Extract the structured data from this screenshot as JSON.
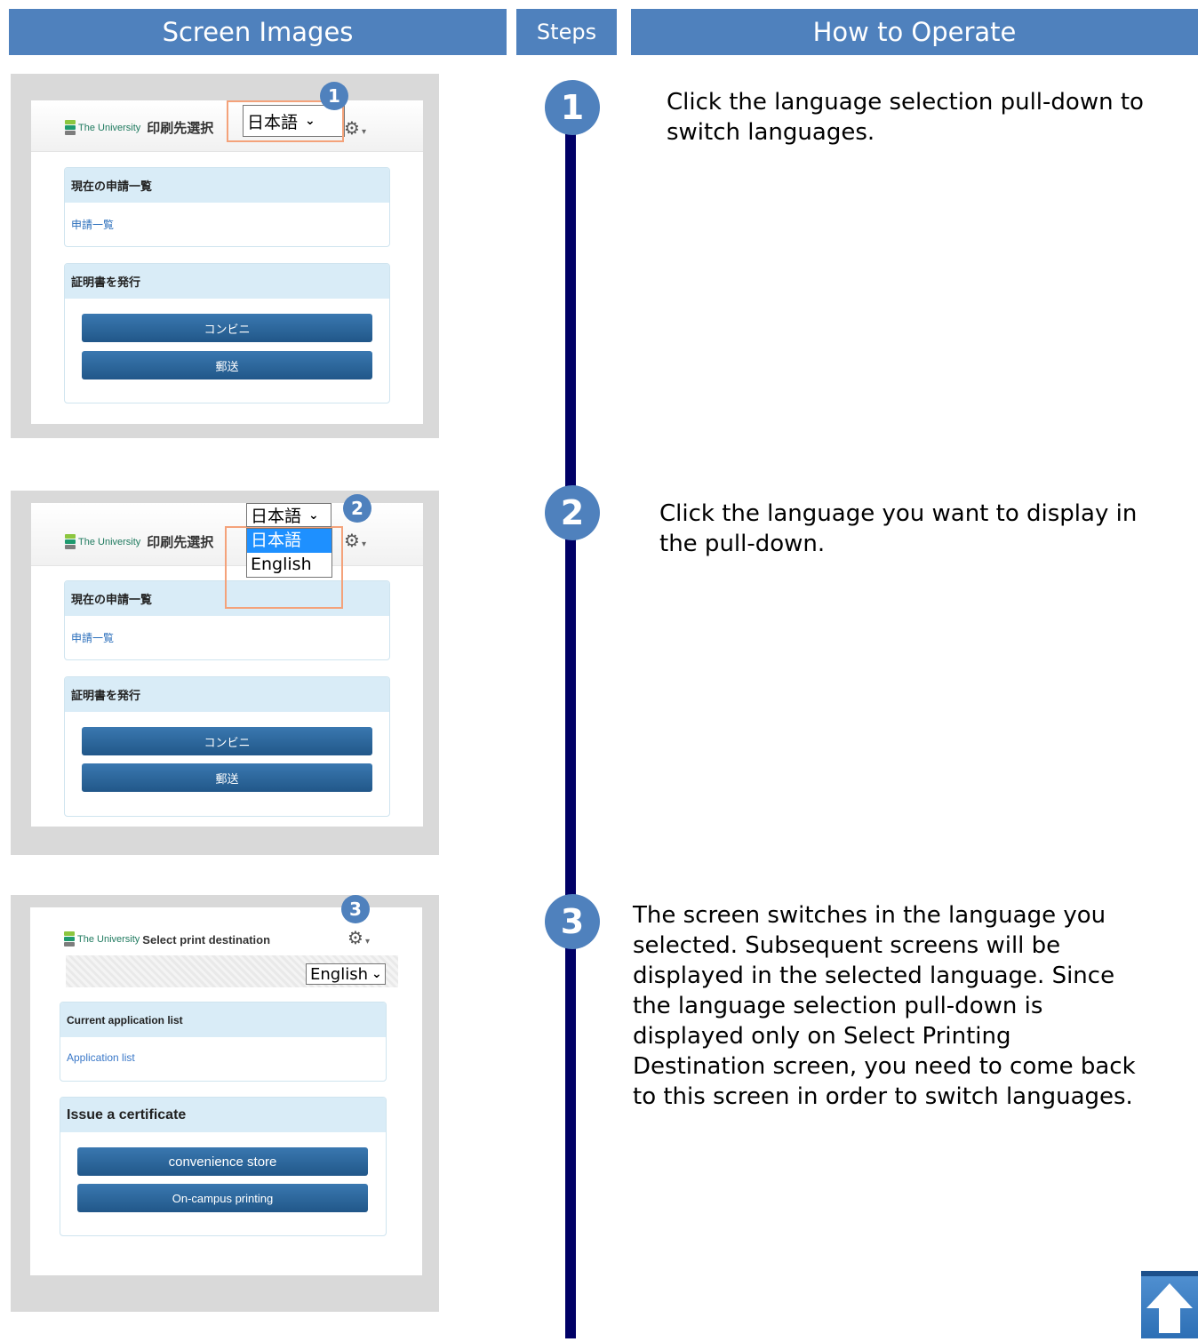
{
  "headers": {
    "screen_images": "Screen Images",
    "steps": "Steps",
    "how_to_operate": "How to Operate"
  },
  "mock_screen_jp": {
    "logo_text": "The University",
    "page_title": "印刷先選択",
    "language_select_value": "日本語",
    "language_options": [
      "日本語",
      "English"
    ],
    "current_applications_header": "現在の申請一覧",
    "application_list_link": "申請一覧",
    "issue_certificate_header": "証明書を発行",
    "convenience_button": "コンビニ",
    "mail_button": "郵送"
  },
  "mock_screen_en": {
    "logo_text": "The University",
    "page_title": "Select print destination",
    "language_select_value": "English",
    "current_applications_header": "Current application list",
    "application_list_link": "Application list",
    "issue_certificate_header": "Issue a certificate",
    "convenience_button": "convenience store",
    "campus_button": "On-campus printing"
  },
  "steps": [
    {
      "number": "1",
      "text": "Click the language selection pull-down to switch languages."
    },
    {
      "number": "2",
      "text": "Click the language you want to display in the pull-down."
    },
    {
      "number": "3",
      "text": "The screen switches in the language you selected. Subsequent screens will be displayed in the selected language. Since the language selection pull-down is displayed only on Select Printing Destination screen, you need to come back to this screen in order to switch languages."
    }
  ],
  "icons": {
    "settings": "gear-icon",
    "back_to_top": "arrow-up-icon"
  },
  "colors": {
    "header_bg": "#4f81bd",
    "timeline": "#000066",
    "highlight": "#f4a27a",
    "button": "#215789"
  }
}
